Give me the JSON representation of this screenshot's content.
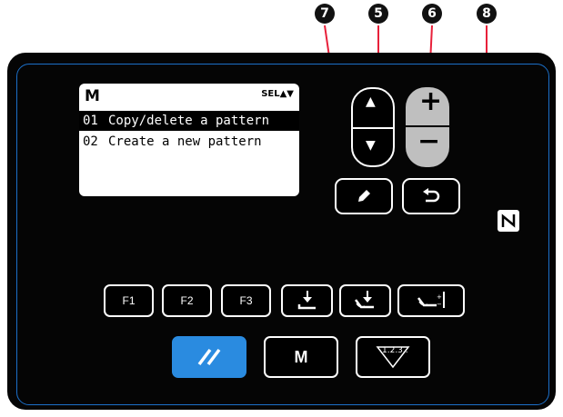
{
  "markers": {
    "m7": "7",
    "m5": "5",
    "m6": "6",
    "m8": "8"
  },
  "lcd": {
    "mode": "M",
    "sel_indicator": "SEL▲▼",
    "items": [
      {
        "num": "01",
        "label": "Copy/delete a pattern",
        "selected": true
      },
      {
        "num": "02",
        "label": "Create a new pattern",
        "selected": false
      }
    ]
  },
  "keys": {
    "up": "▲",
    "down": "▼",
    "plus": "+",
    "minus": "−",
    "f1": "F1",
    "f2": "F2",
    "f3": "F3",
    "mode": "M",
    "counter": "1.2.3.."
  },
  "icons": {
    "edit": "pencil-icon",
    "return": "return-icon",
    "presser_foot": "presser-foot-icon",
    "thread_trim": "thread-trim-icon",
    "stitch_adjust": "stitch-adjust-icon",
    "ready": "ready-icon",
    "nfc": "nfc-icon"
  },
  "colors": {
    "panel": "#050505",
    "accent": "#2a8be0",
    "frame": "#1b6fc8"
  }
}
